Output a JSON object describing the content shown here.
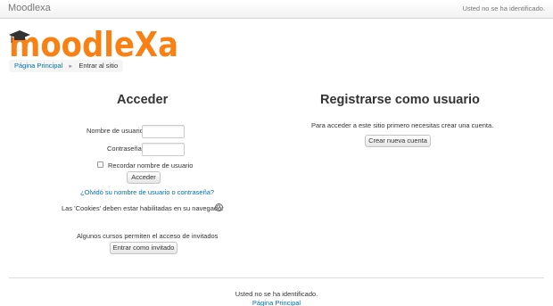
{
  "navbar": {
    "brand": "Moodlexa",
    "login_status": "Usted no se ha identificado."
  },
  "logo": {
    "text": "moodleXa",
    "color": "#f98012",
    "cap_color": "#333333"
  },
  "breadcrumb": {
    "home": "Página Principal",
    "separator": "►",
    "current": "Entrar al sitio"
  },
  "login": {
    "title": "Acceder",
    "username_label": "Nombre de usuario",
    "password_label": "Contraseña",
    "remember_label": "Recordar nombre de usuario",
    "submit_label": "Acceder",
    "forgot_link": "¿Olvidó su nombre de usuario o contraseña?",
    "cookies_notice": "Las 'Cookies' deben estar habilitadas en su navegador",
    "help_icon": "question-circle-icon",
    "guest_notice": "Algunos cursos permiten el acceso de invitados",
    "guest_button": "Entrar como invitado"
  },
  "register": {
    "title": "Registrarse como usuario",
    "instructions": "Para acceder a este sitio primero necesitas crear una cuenta.",
    "button": "Crear nueva cuenta"
  },
  "footer": {
    "status": "Usted no se ha identificado.",
    "home_link": "Página Principal"
  },
  "colors": {
    "link": "#0070a8",
    "accent": "#f98012"
  }
}
